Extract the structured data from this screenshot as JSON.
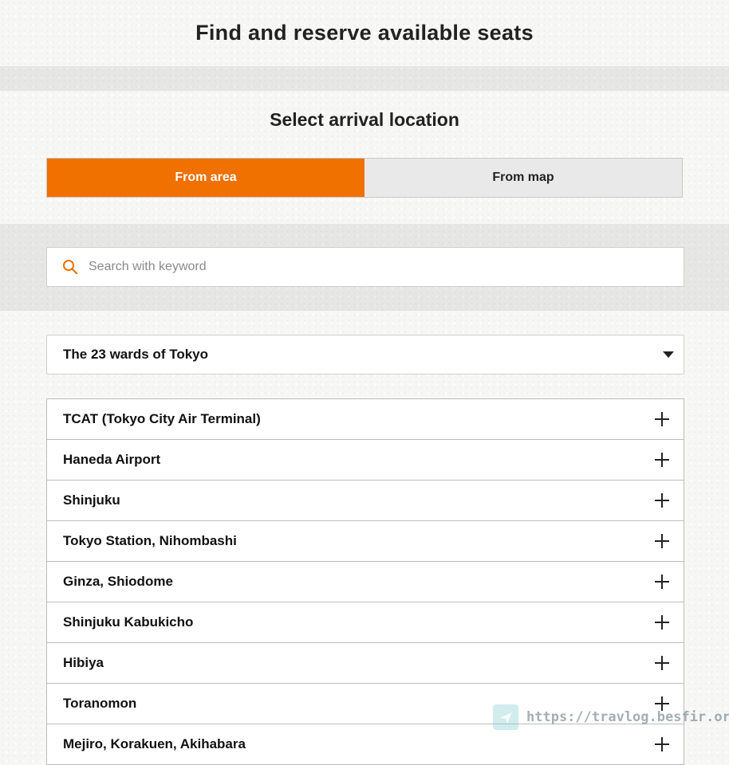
{
  "page_title": "Find and reserve available seats",
  "section_title": "Select arrival location",
  "tabs": [
    {
      "label": "From area",
      "active": true
    },
    {
      "label": "From map",
      "active": false
    }
  ],
  "search": {
    "placeholder": "Search with keyword",
    "value": "",
    "icon": "search-icon"
  },
  "region_select": {
    "selected": "The 23 wards of Tokyo",
    "icon": "caret-down-icon"
  },
  "areas": [
    {
      "label": "TCAT (Tokyo City Air Terminal)"
    },
    {
      "label": "Haneda Airport"
    },
    {
      "label": "Shinjuku"
    },
    {
      "label": "Tokyo Station, Nihombashi"
    },
    {
      "label": "Ginza, Shiodome"
    },
    {
      "label": "Shinjuku Kabukicho"
    },
    {
      "label": "Hibiya"
    },
    {
      "label": "Toranomon"
    },
    {
      "label": "Mejiro, Korakuen, Akihabara"
    }
  ],
  "watermark": {
    "text": "https://travlog.besfir.org/"
  },
  "colors": {
    "accent": "#f07000",
    "tab_inactive": "#e9e9e9",
    "text": "#222222",
    "border": "#bdbdbd"
  }
}
